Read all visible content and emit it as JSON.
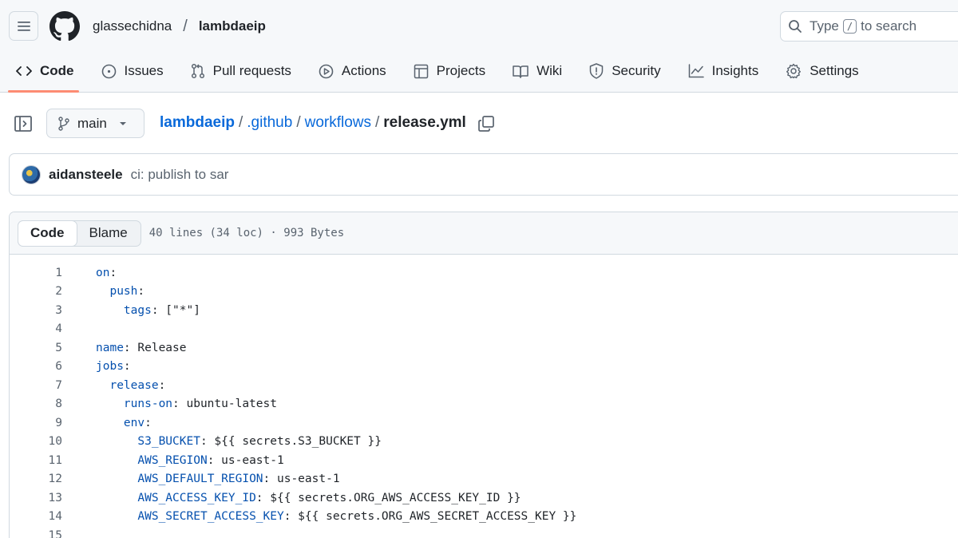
{
  "header": {
    "owner": "glassechidna",
    "repo": "lambdaeip",
    "search": {
      "before": "Type",
      "key": "/",
      "after": "to search"
    }
  },
  "tabs": [
    {
      "label": "Code",
      "icon": "code-icon",
      "active": true
    },
    {
      "label": "Issues",
      "icon": "issue-icon"
    },
    {
      "label": "Pull requests",
      "icon": "pull-request-icon"
    },
    {
      "label": "Actions",
      "icon": "play-icon"
    },
    {
      "label": "Projects",
      "icon": "table-icon"
    },
    {
      "label": "Wiki",
      "icon": "book-icon"
    },
    {
      "label": "Security",
      "icon": "shield-icon"
    },
    {
      "label": "Insights",
      "icon": "graph-icon"
    },
    {
      "label": "Settings",
      "icon": "gear-icon"
    }
  ],
  "file_path": {
    "branch": "main",
    "segments": [
      "lambdaeip",
      ".github",
      "workflows"
    ],
    "separator": "/",
    "file": "release.yml"
  },
  "commit": {
    "author": "aidansteele",
    "message": "ci: publish to sar"
  },
  "code_view": {
    "tab_code": "Code",
    "tab_blame": "Blame",
    "meta": "40 lines (34 loc) · 993 Bytes",
    "lines": [
      {
        "num": "1",
        "indent": "",
        "key": "on",
        "rest": ":"
      },
      {
        "num": "2",
        "indent": "  ",
        "key": "push",
        "rest": ":"
      },
      {
        "num": "3",
        "indent": "    ",
        "key": "tags",
        "rest": ": [\"*\"]"
      },
      {
        "num": "4",
        "indent": "",
        "key": "",
        "rest": ""
      },
      {
        "num": "5",
        "indent": "",
        "key": "name",
        "rest": ": Release"
      },
      {
        "num": "6",
        "indent": "",
        "key": "jobs",
        "rest": ":"
      },
      {
        "num": "7",
        "indent": "  ",
        "key": "release",
        "rest": ":"
      },
      {
        "num": "8",
        "indent": "    ",
        "key": "runs-on",
        "rest": ": ubuntu-latest"
      },
      {
        "num": "9",
        "indent": "    ",
        "key": "env",
        "rest": ":"
      },
      {
        "num": "10",
        "indent": "      ",
        "key": "S3_BUCKET",
        "rest": ": ${{ secrets.S3_BUCKET }}"
      },
      {
        "num": "11",
        "indent": "      ",
        "key": "AWS_REGION",
        "rest": ": us-east-1"
      },
      {
        "num": "12",
        "indent": "      ",
        "key": "AWS_DEFAULT_REGION",
        "rest": ": us-east-1"
      },
      {
        "num": "13",
        "indent": "      ",
        "key": "AWS_ACCESS_KEY_ID",
        "rest": ": ${{ secrets.ORG_AWS_ACCESS_KEY_ID }}"
      },
      {
        "num": "14",
        "indent": "      ",
        "key": "AWS_SECRET_ACCESS_KEY",
        "rest": ": ${{ secrets.ORG_AWS_SECRET_ACCESS_KEY }}"
      },
      {
        "num": "15",
        "indent": "",
        "key": "",
        "rest": ""
      }
    ]
  },
  "colors": {
    "link": "#0969da",
    "yaml_key": "#0550ae",
    "active_tab_underline": "#fd8c73"
  }
}
